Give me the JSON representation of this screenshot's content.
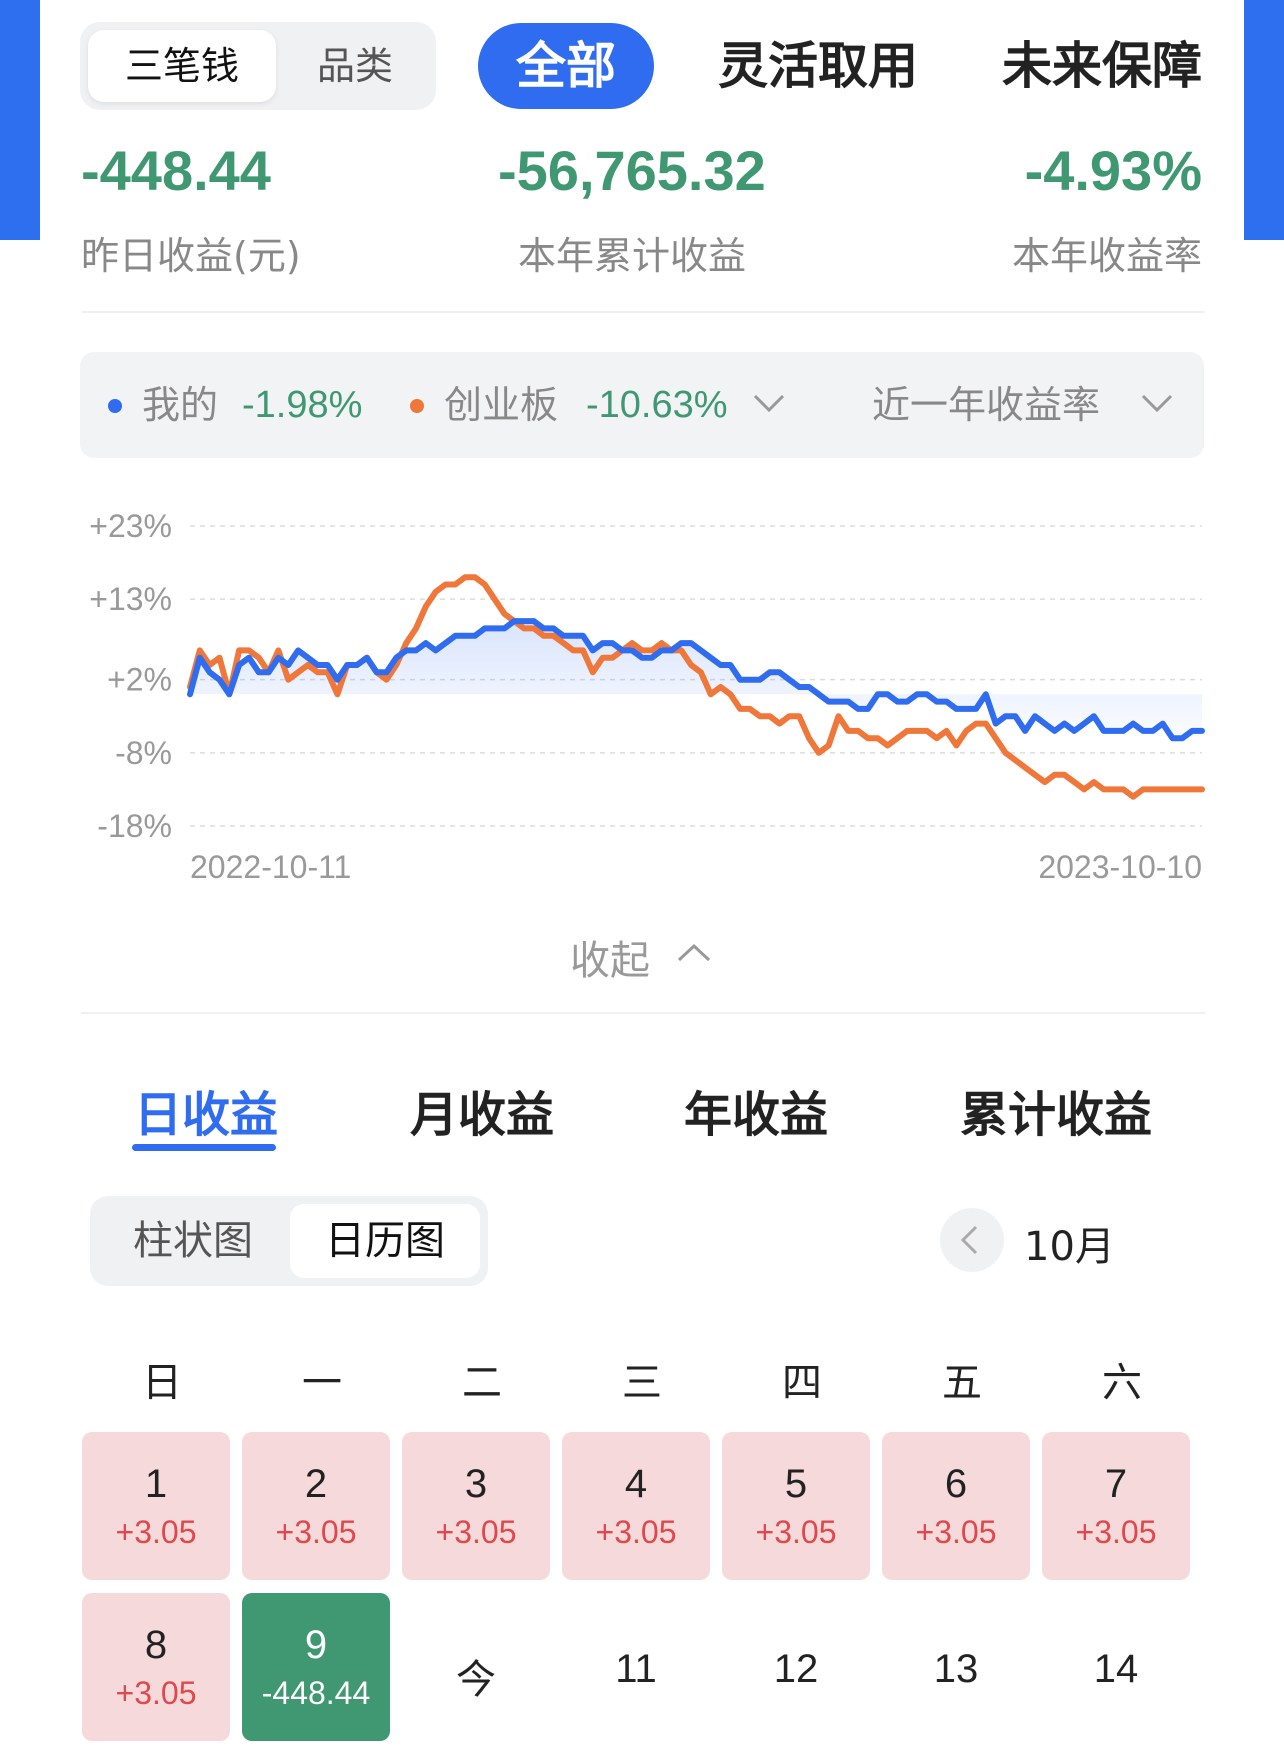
{
  "top_segment": {
    "items": [
      "三笔钱",
      "品类"
    ],
    "active": 0
  },
  "top_tabs": [
    "全部",
    "灵活取用",
    "未来保障"
  ],
  "stats": [
    {
      "value": "-448.44",
      "label": "昨日收益(元)"
    },
    {
      "value": "-56,765.32",
      "label": "本年累计收益"
    },
    {
      "value": "-4.93%",
      "label": "本年收益率"
    }
  ],
  "legend": {
    "mine_label": "我的",
    "mine_value": "-1.98%",
    "bench_label": "创业板",
    "bench_value": "-10.63%",
    "period": "近一年收益率"
  },
  "colors": {
    "blue": "#2f6cf0",
    "orange": "#f0773a",
    "green": "#3f9871",
    "red": "#e0484c"
  },
  "chart_data": {
    "type": "line",
    "ylim": [
      -18,
      23
    ],
    "y_ticks": [
      "+23%",
      "+13%",
      "+2%",
      "-8%",
      "-18%"
    ],
    "x_start": "2022-10-11",
    "x_end": "2023-10-10",
    "series": [
      {
        "name": "我的",
        "color": "#2f6cf0",
        "values": [
          0,
          5,
          3,
          2,
          0,
          4,
          5,
          3,
          3,
          5,
          4,
          6,
          5,
          4,
          4,
          2,
          4,
          4,
          5,
          3,
          3,
          5,
          6,
          6,
          7,
          6,
          7,
          8,
          8,
          8,
          9,
          9,
          9,
          10,
          10,
          10,
          9,
          9,
          8,
          8,
          8,
          6,
          7,
          7,
          6,
          6,
          5,
          5,
          6,
          6,
          7,
          7,
          6,
          5,
          4,
          4,
          2,
          2,
          2,
          3,
          3,
          2,
          1,
          1,
          0,
          -1,
          -1,
          -1,
          -2,
          -2,
          0,
          0,
          -1,
          -1,
          0,
          0,
          -1,
          -1,
          -2,
          -2,
          -2,
          0,
          -4,
          -3,
          -3,
          -5,
          -3,
          -4,
          -5,
          -4,
          -5,
          -4,
          -3,
          -5,
          -5,
          -5,
          -4,
          -5,
          -5,
          -4,
          -6,
          -6,
          -5,
          -5
        ]
      },
      {
        "name": "创业板",
        "color": "#f0773a",
        "values": [
          1,
          6,
          4,
          5,
          0,
          6,
          6,
          5,
          3,
          6,
          2,
          3,
          4,
          3,
          3,
          0,
          4,
          4,
          5,
          3,
          2,
          4,
          7,
          9,
          12,
          14,
          15,
          15,
          16,
          16,
          15,
          13,
          11,
          10,
          9,
          9,
          8,
          8,
          7,
          6,
          6,
          3,
          5,
          5,
          6,
          7,
          6,
          6,
          7,
          6,
          6,
          4,
          3,
          0,
          1,
          0,
          -2,
          -2,
          -3,
          -3,
          -4,
          -3,
          -3,
          -6,
          -8,
          -7,
          -3,
          -5,
          -5,
          -6,
          -6,
          -7,
          -6,
          -5,
          -5,
          -5,
          -6,
          -5,
          -7,
          -5,
          -4,
          -4,
          -6,
          -8,
          -9,
          -10,
          -11,
          -12,
          -11,
          -11,
          -12,
          -13,
          -12,
          -13,
          -13,
          -13,
          -14,
          -13,
          -13,
          -13,
          -13,
          -13,
          -13,
          -13
        ]
      }
    ]
  },
  "collapse_label": "收起",
  "earn_tabs": {
    "items": [
      "日收益",
      "月收益",
      "年收益",
      "累计收益"
    ],
    "active": 0
  },
  "view_toggle": {
    "items": [
      "柱状图",
      "日历图"
    ],
    "active": 1
  },
  "month": "10月",
  "weekdays": [
    "日",
    "一",
    "二",
    "三",
    "四",
    "五",
    "六"
  ],
  "calendar": [
    {
      "day": "1",
      "value": "+3.05"
    },
    {
      "day": "2",
      "value": "+3.05"
    },
    {
      "day": "3",
      "value": "+3.05"
    },
    {
      "day": "4",
      "value": "+3.05"
    },
    {
      "day": "5",
      "value": "+3.05"
    },
    {
      "day": "6",
      "value": "+3.05"
    },
    {
      "day": "7",
      "value": "+3.05"
    },
    {
      "day": "8",
      "value": "+3.05"
    },
    {
      "day": "9",
      "value": "-448.44"
    },
    {
      "day": "今",
      "value": ""
    },
    {
      "day": "11",
      "value": ""
    },
    {
      "day": "12",
      "value": ""
    },
    {
      "day": "13",
      "value": ""
    },
    {
      "day": "14",
      "value": ""
    }
  ]
}
